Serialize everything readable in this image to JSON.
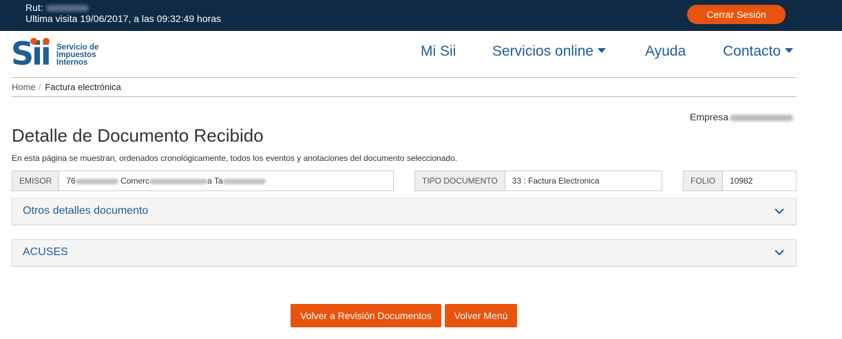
{
  "topbar": {
    "rut_label": "Rut:",
    "last_visit": "Ultima visita 19/06/2017, a las 09:32:49 horas",
    "logout_label": "Cerrar Sesión"
  },
  "logo": {
    "mark": "Sii",
    "line1": "Servicio de",
    "line2": "Impuestos",
    "line3": "Internos"
  },
  "nav": {
    "items": [
      {
        "label": "Mi Sii"
      },
      {
        "label": "Servicios online"
      },
      {
        "label": "Ayuda"
      },
      {
        "label": "Contacto"
      }
    ]
  },
  "breadcrumb": {
    "home": "Home",
    "separator": "/",
    "current": "Factura electrónica"
  },
  "empresa_label": "Empresa",
  "page": {
    "title": "Detalle de Documento Recibido",
    "description": "En esta página se muestran, ordenados cronológicamente, todos los eventos y anotaciones del documento seleccionado."
  },
  "fields": {
    "emisor": {
      "label": "EMISOR",
      "value_prefix": "76",
      "value_mid": "Comerc",
      "value_end": "a Ta"
    },
    "tipo": {
      "label": "TIPO DOCUMENTO",
      "value": "33 : Factura Electronica"
    },
    "folio": {
      "label": "FOLIO",
      "value": "10982"
    }
  },
  "panels": [
    {
      "title": "Otros detalles documento"
    },
    {
      "title": "ACUSES"
    }
  ],
  "buttons": {
    "back_review": "Volver a Revisión Documentos",
    "back_menu": "Volver Menú"
  },
  "colors": {
    "topbar_bg": "#0e2a45",
    "accent_orange": "#e8540d",
    "brand_blue": "#1f5d97"
  }
}
